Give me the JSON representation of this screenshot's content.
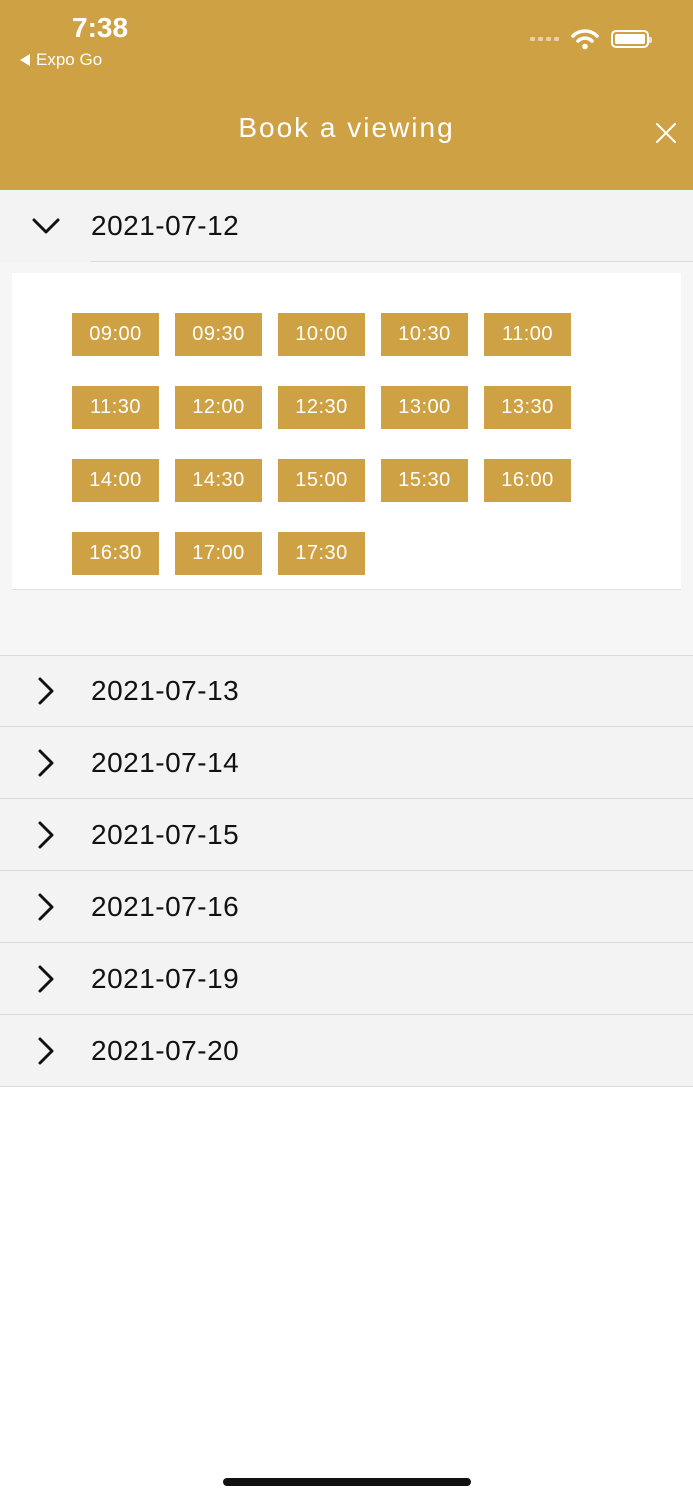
{
  "status_bar": {
    "time": "7:38",
    "back_app": "Expo Go"
  },
  "header": {
    "title": "Book a viewing",
    "accent_color": "#cea244"
  },
  "expanded_day": {
    "date": "2021-07-12",
    "slots": [
      "09:00",
      "09:30",
      "10:00",
      "10:30",
      "11:00",
      "11:30",
      "12:00",
      "12:30",
      "13:00",
      "13:30",
      "14:00",
      "14:30",
      "15:00",
      "15:30",
      "16:00",
      "16:30",
      "17:00",
      "17:30"
    ]
  },
  "collapsed_days": [
    "2021-07-13",
    "2021-07-14",
    "2021-07-15",
    "2021-07-16",
    "2021-07-19",
    "2021-07-20"
  ]
}
